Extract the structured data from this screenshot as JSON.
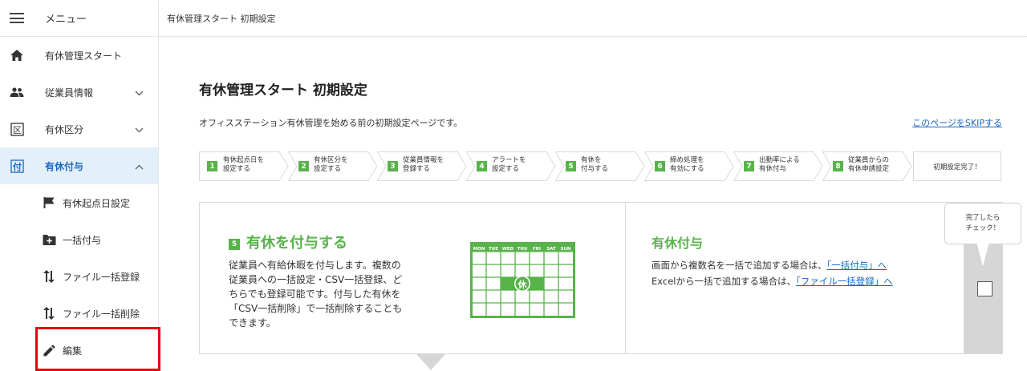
{
  "sidebar": {
    "menu_label": "メニュー",
    "items": [
      {
        "label": "有休管理スタート",
        "icon": "home-icon"
      },
      {
        "label": "従業員情報",
        "icon": "people-icon"
      },
      {
        "label": "有休区分",
        "icon": "ku-icon",
        "icon_char": "区"
      },
      {
        "label": "有休付与",
        "icon": "fu-icon",
        "icon_char": "付",
        "active": true
      }
    ],
    "sub_items": [
      {
        "label": "有休起点日設定",
        "icon": "flag-icon"
      },
      {
        "label": "一括付与",
        "icon": "add-box-icon"
      },
      {
        "label": "ファイル一括登録",
        "icon": "swap-vertical-icon"
      },
      {
        "label": "ファイル一括削除",
        "icon": "swap-vertical-icon"
      },
      {
        "label": "編集",
        "icon": "pencil-icon"
      }
    ]
  },
  "header": {
    "breadcrumb": "有休管理スタート 初期設定"
  },
  "main": {
    "title": "有休管理スタート 初期設定",
    "description": "オフィスステーション有休管理を始める前の初期設定ページです。",
    "skip_link": "このページをSKIPする",
    "steps": [
      {
        "num": "1",
        "line1": "有休起点日を",
        "line2": "設定する"
      },
      {
        "num": "2",
        "line1": "有休区分を",
        "line2": "設定する"
      },
      {
        "num": "3",
        "line1": "従業員情報を",
        "line2": "登録する"
      },
      {
        "num": "4",
        "line1": "アラートを",
        "line2": "設定する"
      },
      {
        "num": "5",
        "line1": "有休を",
        "line2": "付与する"
      },
      {
        "num": "6",
        "line1": "締め処理を",
        "line2": "有効にする"
      },
      {
        "num": "7",
        "line1": "出勤率による",
        "line2": "有休付与"
      },
      {
        "num": "8",
        "line1": "従業員からの",
        "line2": "有休申請設定"
      }
    ],
    "final_step": "初期設定完了！",
    "card": {
      "step_num": "5",
      "left_title": "有休を付与する",
      "left_body": [
        "従業員へ有給休暇を付与します。複数の",
        "従業員への一括設定・CSV一括登録、ど",
        "ちらでも登録可能です。付与した有休を",
        "「CSV一括削除」で一括削除することも",
        "できます。"
      ],
      "calendar_days": [
        "MON",
        "TUE",
        "WED",
        "THU",
        "FRI",
        "SAT",
        "SUN"
      ],
      "calendar_mark": "休",
      "right_title": "有休付与",
      "right_line1_text": "画面から複数名を一括で追加する場合は、",
      "right_line1_link": "「一括付与」へ",
      "right_line2_text": "Excelから一括で追加する場合は、",
      "right_line2_link": "「ファイル一括登録」へ",
      "check_bubble_line1": "完了したら",
      "check_bubble_line2": "チェック！"
    }
  },
  "colors": {
    "accent_green": "#58b34a",
    "link_blue": "#1a66c2",
    "active_bg": "#e3f0fb",
    "highlight_red": "#e60012"
  }
}
